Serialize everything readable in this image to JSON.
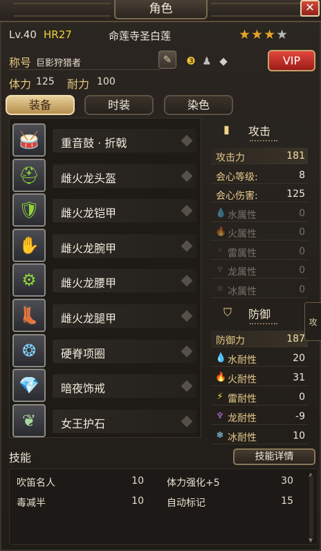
{
  "window": {
    "title": "角色",
    "close_symbol": "✕"
  },
  "character": {
    "level": "Lv.40",
    "hr": "HR27",
    "name": "命莲寺圣白莲",
    "stars_filled": 3,
    "stars_total": 4,
    "title_label": "称号",
    "title_value": "巨影狩猎者",
    "vip_label": "VIP",
    "stamina_label": "体力",
    "stamina_value": "125",
    "endurance_label": "耐力",
    "endurance_value": "100"
  },
  "tabs": [
    {
      "label": "装备",
      "active": true
    },
    {
      "label": "时装",
      "active": false
    },
    {
      "label": "染色",
      "active": false
    }
  ],
  "equipment": [
    {
      "name": "重音鼓 · 折戟",
      "icon": "hunting-horn-icon",
      "glyph": "🥁"
    },
    {
      "name": "雌火龙头盔",
      "icon": "helmet-icon",
      "glyph": "⛑"
    },
    {
      "name": "雌火龙铠甲",
      "icon": "chest-armor-icon",
      "glyph": "🛡"
    },
    {
      "name": "雌火龙腕甲",
      "icon": "gauntlet-icon",
      "glyph": "✋"
    },
    {
      "name": "雌火龙腰甲",
      "icon": "waist-armor-icon",
      "glyph": "⚙"
    },
    {
      "name": "雌火龙腿甲",
      "icon": "leg-armor-icon",
      "glyph": "👢"
    },
    {
      "name": "硬脊项圈",
      "icon": "necklace-icon",
      "glyph": "❂"
    },
    {
      "name": "暗夜饰戒",
      "icon": "ring-icon",
      "glyph": "💎"
    },
    {
      "name": "女王护石",
      "icon": "charm-icon",
      "glyph": "❦"
    }
  ],
  "attack": {
    "heading": "攻击",
    "rows": [
      {
        "label": "攻击力",
        "value": "181",
        "dim": false
      },
      {
        "label": "会心等级:",
        "value": "8",
        "dim": false
      },
      {
        "label": "会心伤害:",
        "value": "125",
        "dim": false
      },
      {
        "label": "水属性",
        "value": "0",
        "dim": true,
        "icon": "water-drop-icon",
        "glyph": "💧"
      },
      {
        "label": "火属性",
        "value": "0",
        "dim": true,
        "icon": "fire-icon",
        "glyph": "🔥"
      },
      {
        "label": "雷属性",
        "value": "0",
        "dim": true,
        "icon": "thunder-icon",
        "glyph": "⚡"
      },
      {
        "label": "龙属性",
        "value": "0",
        "dim": true,
        "icon": "dragon-icon",
        "glyph": "♆"
      },
      {
        "label": "冰属性",
        "value": "0",
        "dim": true,
        "icon": "ice-icon",
        "glyph": "❄"
      }
    ]
  },
  "defense": {
    "heading": "防御",
    "rows": [
      {
        "label": "防御力",
        "value": "187",
        "dim": false
      },
      {
        "label": "水耐性",
        "value": "20",
        "dim": false,
        "icon": "water-drop-icon",
        "glyph": "💧",
        "color": "#7fc8f0"
      },
      {
        "label": "火耐性",
        "value": "31",
        "dim": false,
        "icon": "fire-icon",
        "glyph": "🔥",
        "color": "#ff6a3a"
      },
      {
        "label": "雷耐性",
        "value": "0",
        "dim": false,
        "icon": "thunder-icon",
        "glyph": "⚡",
        "color": "#f5e03a"
      },
      {
        "label": "龙耐性",
        "value": "-9",
        "dim": false,
        "icon": "dragon-icon",
        "glyph": "♆",
        "color": "#b06ad8"
      },
      {
        "label": "冰耐性",
        "value": "10",
        "dim": false,
        "icon": "ice-icon",
        "glyph": "❄",
        "color": "#9ad8ff"
      }
    ]
  },
  "skills": {
    "label": "技能",
    "details_button": "技能详情",
    "items": [
      {
        "name": "吹笛名人",
        "value": "10"
      },
      {
        "name": "体力强化+5",
        "value": "30"
      },
      {
        "name": "毒减半",
        "value": "10"
      },
      {
        "name": "自动标记",
        "value": "15"
      }
    ]
  },
  "side_handle_label": "攻",
  "colors": {
    "accent_gold": "#e7c97d",
    "hr_yellow": "#f3d13b",
    "vip_red": "#d23a2f",
    "active_tab": "#e7cf99"
  }
}
